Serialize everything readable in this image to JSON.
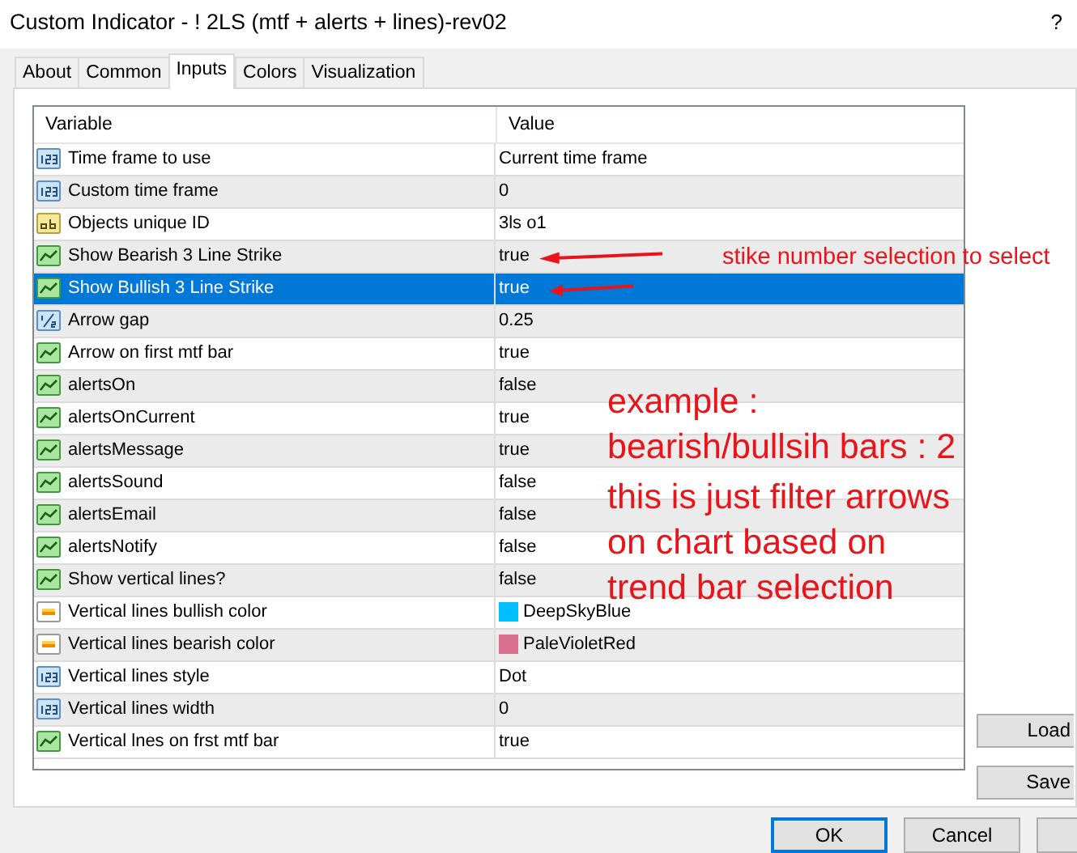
{
  "window": {
    "title": "Custom Indicator - ! 2LS (mtf + alerts + lines)-rev02",
    "help": "?"
  },
  "tabs": [
    {
      "label": "About",
      "selected": false
    },
    {
      "label": "Common",
      "selected": false
    },
    {
      "label": "Inputs",
      "selected": true
    },
    {
      "label": "Colors",
      "selected": false
    },
    {
      "label": "Visualization",
      "selected": false
    }
  ],
  "table": {
    "columns": [
      "Variable",
      "Value"
    ],
    "rows": [
      {
        "kind": "int",
        "variable": "Time frame to use",
        "value": "Current time frame",
        "selected": false,
        "annotated": false
      },
      {
        "kind": "int",
        "variable": "Custom time frame",
        "value": "0",
        "selected": false,
        "annotated": false
      },
      {
        "kind": "string",
        "variable": "Objects unique ID",
        "value": "3ls o1",
        "selected": false,
        "annotated": false
      },
      {
        "kind": "bool",
        "variable": "Show Bearish 3 Line Strike",
        "value": "true",
        "selected": false,
        "annotated": true
      },
      {
        "kind": "bool",
        "variable": "Show Bullish 3 Line Strike",
        "value": "true",
        "selected": true,
        "annotated": true
      },
      {
        "kind": "double",
        "variable": "Arrow gap",
        "value": "0.25",
        "selected": false,
        "annotated": false
      },
      {
        "kind": "bool",
        "variable": "Arrow on first mtf bar",
        "value": "true",
        "selected": false,
        "annotated": false
      },
      {
        "kind": "bool",
        "variable": "alertsOn",
        "value": "false",
        "selected": false,
        "annotated": false
      },
      {
        "kind": "bool",
        "variable": "alertsOnCurrent",
        "value": "true",
        "selected": false,
        "annotated": false
      },
      {
        "kind": "bool",
        "variable": "alertsMessage",
        "value": "true",
        "selected": false,
        "annotated": false
      },
      {
        "kind": "bool",
        "variable": "alertsSound",
        "value": "false",
        "selected": false,
        "annotated": false
      },
      {
        "kind": "bool",
        "variable": "alertsEmail",
        "value": "false",
        "selected": false,
        "annotated": false
      },
      {
        "kind": "bool",
        "variable": "alertsNotify",
        "value": "false",
        "selected": false,
        "annotated": false
      },
      {
        "kind": "bool",
        "variable": "Show vertical lines?",
        "value": "false",
        "selected": false,
        "annotated": false
      },
      {
        "kind": "color",
        "variable": "Vertical lines bullish color",
        "value": "DeepSkyBlue",
        "color": "#00bfff",
        "selected": false,
        "annotated": false
      },
      {
        "kind": "color",
        "variable": "Vertical lines bearish color",
        "value": "PaleVioletRed",
        "color": "#db7093",
        "selected": false,
        "annotated": false
      },
      {
        "kind": "int",
        "variable": "Vertical lines style",
        "value": "Dot",
        "selected": false,
        "annotated": false
      },
      {
        "kind": "int",
        "variable": "Vertical lines width",
        "value": "0",
        "selected": false,
        "annotated": false
      },
      {
        "kind": "bool",
        "variable": "Vertical lnes on frst mtf bar",
        "value": "true",
        "selected": false,
        "annotated": false
      }
    ]
  },
  "side_buttons": [
    "Load",
    "Save"
  ],
  "footer_buttons": [
    {
      "label": "OK",
      "default": true
    },
    {
      "label": "Cancel",
      "default": false
    },
    {
      "default": false
    }
  ],
  "notes": {
    "small": "stike number selection to select",
    "large": [
      [
        "example :",
        "bearish/bullsih bars : 2"
      ],
      [
        "this is just filter arrows",
        "on chart based on",
        "trend bar selection"
      ]
    ]
  }
}
